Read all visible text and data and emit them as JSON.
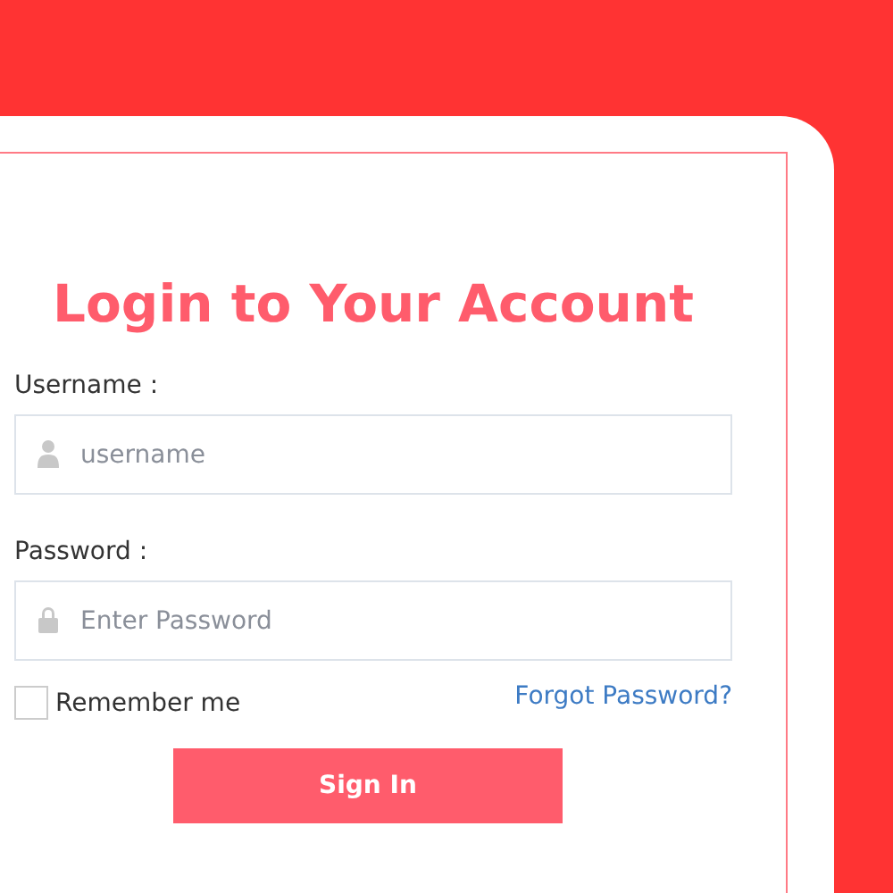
{
  "title": "Login to Your Account",
  "username": {
    "label": "Username :",
    "placeholder": "username"
  },
  "password": {
    "label": "Password :",
    "placeholder": "Enter Password"
  },
  "remember": {
    "label": "Remember me",
    "checked": false
  },
  "forgot_link": "Forgot Password?",
  "submit_button": "Sign In"
}
